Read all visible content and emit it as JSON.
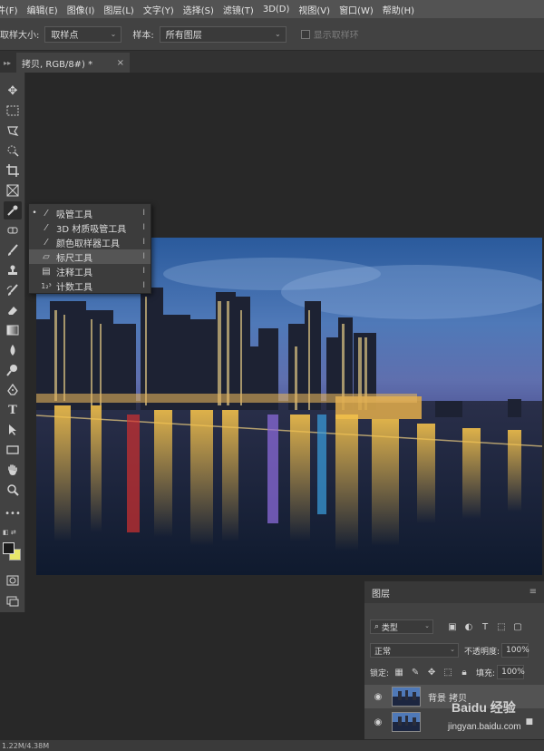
{
  "menubar": {
    "items": [
      "件(F)",
      "编辑(E)",
      "图像(I)",
      "图层(L)",
      "文字(Y)",
      "选择(S)",
      "滤镜(T)",
      "3D(D)",
      "视图(V)",
      "窗口(W)",
      "帮助(H)"
    ]
  },
  "options": {
    "sample_size_label": "取样大小:",
    "sample_size_value": "取样点",
    "sample_label": "样本:",
    "sample_value": "所有图层",
    "show_ring_label": "显示取样环"
  },
  "document_tab": {
    "title": "拷贝, RGB/8#) *",
    "close": "×"
  },
  "toolbar": {
    "icons": [
      "move-icon",
      "marquee-icon",
      "lasso-icon",
      "quick-select-icon",
      "crop-icon",
      "frame-icon",
      "eyedropper-icon",
      "healing-icon",
      "brush-icon",
      "stamp-icon",
      "history-brush-icon",
      "eraser-icon",
      "gradient-icon",
      "blur-icon",
      "dodge-icon",
      "pen-icon",
      "type-icon",
      "path-select-icon",
      "rectangle-icon",
      "hand-icon",
      "zoom-icon",
      "more-icon"
    ]
  },
  "flyout": {
    "items": [
      {
        "label": "吸管工具",
        "key": "I",
        "icon": "eyedropper-icon",
        "current": true
      },
      {
        "label": "3D 材质吸管工具",
        "key": "I",
        "icon": "3d-eyedropper-icon",
        "current": false
      },
      {
        "label": "颜色取样器工具",
        "key": "I",
        "icon": "color-sampler-icon",
        "current": false
      },
      {
        "label": "标尺工具",
        "key": "I",
        "icon": "ruler-icon",
        "current": false
      },
      {
        "label": "注释工具",
        "key": "I",
        "icon": "note-icon",
        "current": false
      },
      {
        "label": "计数工具",
        "key": "I",
        "icon": "count-icon",
        "current": false
      }
    ],
    "count_prefix": "1₂³"
  },
  "layers_panel": {
    "tab": "图层",
    "filter_value": "类型",
    "blend_mode": "正常",
    "opacity_label": "不透明度:",
    "opacity_value": "100%",
    "lock_label": "锁定:",
    "fill_label": "填充:",
    "fill_value": "100%",
    "layers": [
      {
        "name": "背景 拷贝",
        "selected": true,
        "locked": false
      },
      {
        "name": "",
        "selected": false,
        "locked": true
      }
    ]
  },
  "status": {
    "text": "1.22M/4.38M"
  },
  "watermark": {
    "line1": "Baidu 经验",
    "line2": "jingyan.baidu.com"
  },
  "colors": {
    "foreground": "#1a1a1a",
    "background": "#e8e86a"
  }
}
